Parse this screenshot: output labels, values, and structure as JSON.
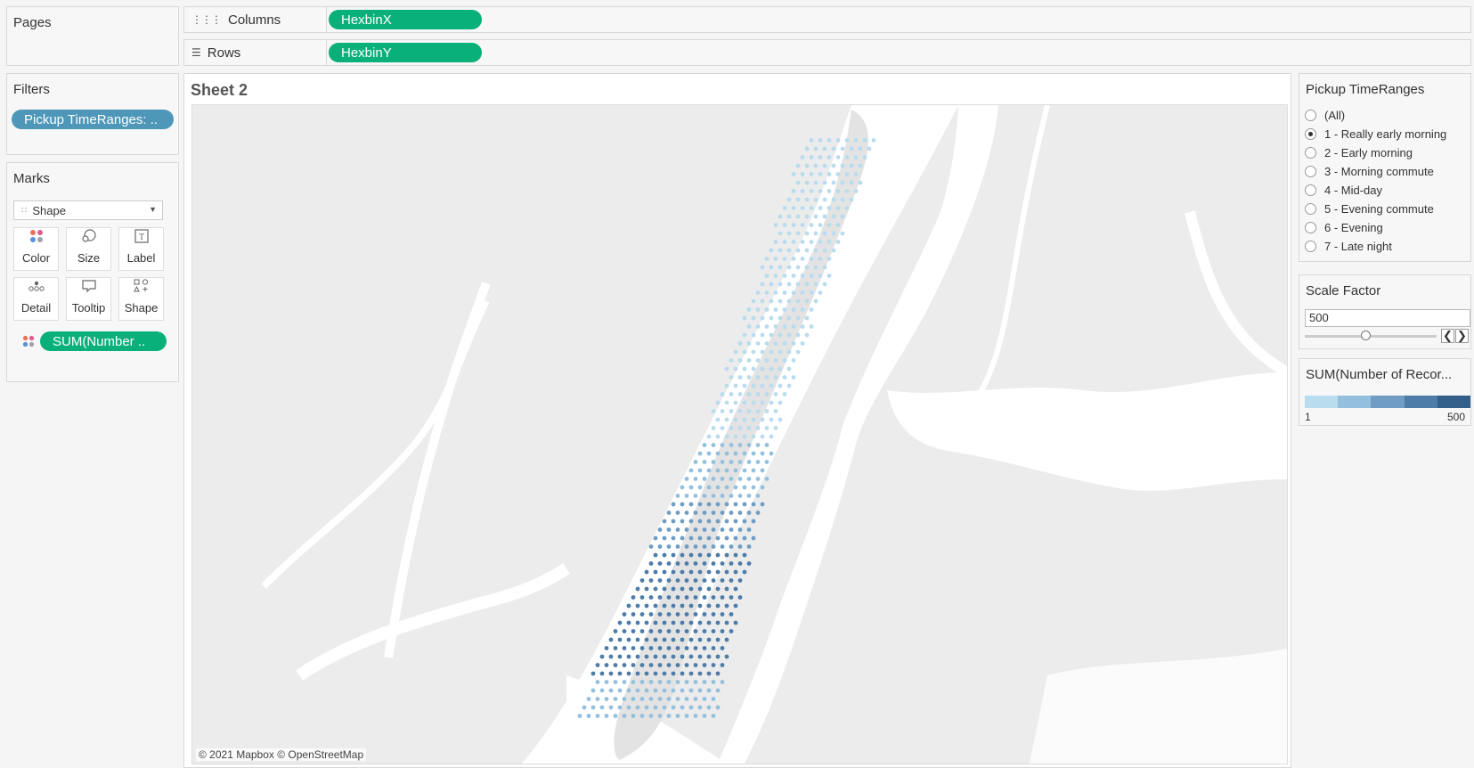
{
  "pages": {
    "title": "Pages"
  },
  "columns": {
    "label": "Columns",
    "pill": "HexbinX"
  },
  "rows": {
    "label": "Rows",
    "pill": "HexbinY"
  },
  "filters": {
    "title": "Filters",
    "pill": "Pickup TimeRanges: .."
  },
  "marks": {
    "title": "Marks",
    "type": "Shape",
    "buttons": [
      "Color",
      "Size",
      "Label",
      "Detail",
      "Tooltip",
      "Shape"
    ],
    "field_pill": "SUM(Number .."
  },
  "sheet": {
    "title": "Sheet 2",
    "attribution": "© 2021 Mapbox © OpenStreetMap"
  },
  "pickup": {
    "title": "Pickup TimeRanges",
    "selected_index": 1,
    "options": [
      "(All)",
      "1 - Really early morning",
      "2 - Early morning",
      "3 - Morning commute",
      "4 - Mid-day",
      "5 - Evening commute",
      "6 - Evening",
      "7 - Late night"
    ]
  },
  "scale": {
    "title": "Scale Factor",
    "value": "500",
    "slider_fraction": 0.5
  },
  "legend": {
    "title": "SUM(Number of Recor...",
    "min": "1",
    "max": "500",
    "colors": [
      "#b9dcef",
      "#94c0dd",
      "#6f9dc4",
      "#4e7ca8",
      "#335f8b"
    ]
  }
}
